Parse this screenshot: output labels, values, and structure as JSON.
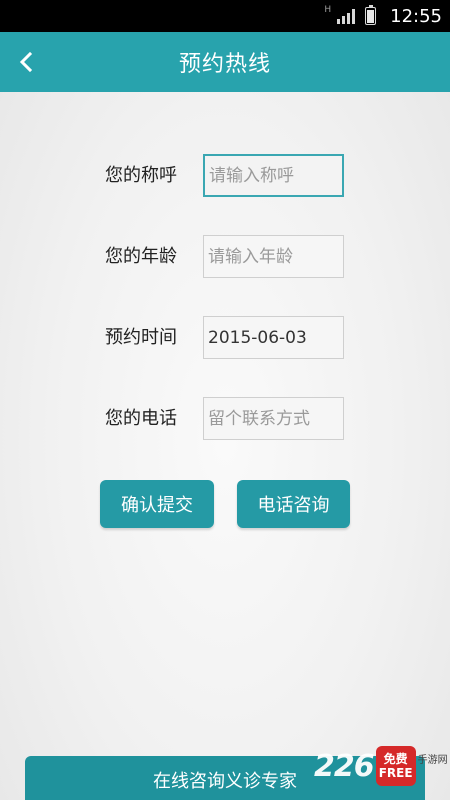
{
  "status_bar": {
    "network_type": "H",
    "time": "12:55",
    "icons": [
      "signal-icon",
      "battery-icon"
    ]
  },
  "header": {
    "title": "预约热线",
    "back_icon": "chevron-left-icon"
  },
  "form": {
    "name": {
      "label": "您的称呼",
      "value": "",
      "placeholder": "请输入称呼"
    },
    "age": {
      "label": "您的年龄",
      "value": "",
      "placeholder": "请输入年龄"
    },
    "date": {
      "label": "预约时间",
      "value": "2015-06-03",
      "placeholder": ""
    },
    "phone": {
      "label": "您的电话",
      "value": "",
      "placeholder": "留个联系方式"
    }
  },
  "buttons": {
    "confirm_label": "确认提交",
    "phone_label": "电话咨询"
  },
  "bottom_bar": {
    "label": "在线咨询义诊专家"
  },
  "watermark": {
    "number": "226",
    "badge_top": "免费",
    "badge_bottom": "FREE",
    "site": "手游网"
  },
  "colors": {
    "accent": "#28a3ad",
    "button": "#259aa5",
    "bottom_bar": "#1f929c",
    "status_bar": "#000000"
  }
}
